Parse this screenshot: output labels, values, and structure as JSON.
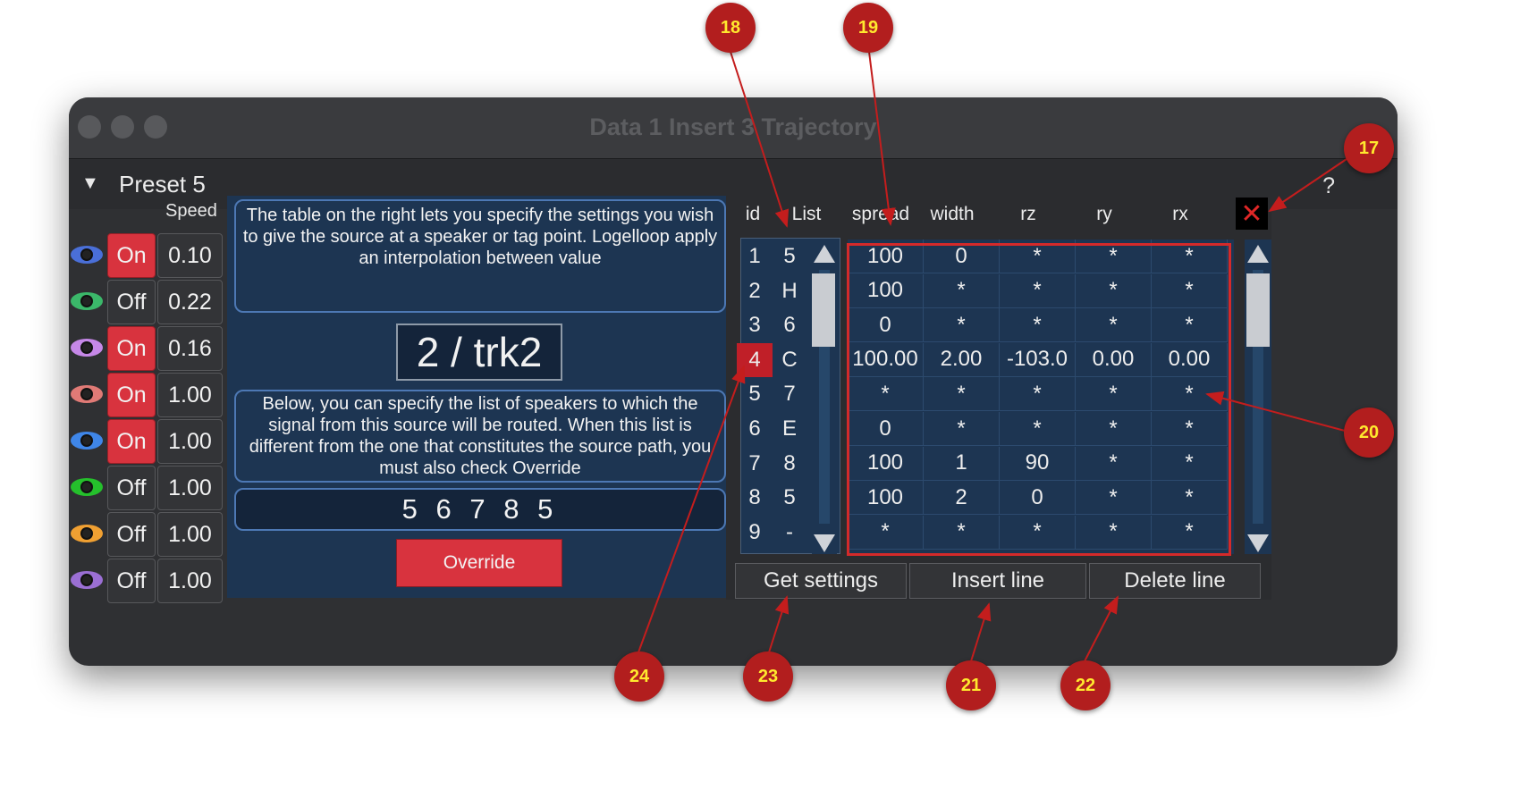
{
  "window": {
    "title": "Data 1 Insert 3 Trajectory"
  },
  "preset": {
    "label": "Preset 5",
    "help": "?"
  },
  "left": {
    "speed_header": "Speed",
    "rows": [
      {
        "eye_color": "#4a6fd8",
        "state": "On",
        "speed": "0.10"
      },
      {
        "eye_color": "#3bb86a",
        "state": "Off",
        "speed": "0.22"
      },
      {
        "eye_color": "#c688e8",
        "state": "On",
        "speed": "0.16"
      },
      {
        "eye_color": "#e07a76",
        "state": "On",
        "speed": "1.00"
      },
      {
        "eye_color": "#3f86e8",
        "state": "On",
        "speed": "1.00"
      },
      {
        "eye_color": "#25c02c",
        "state": "Off",
        "speed": "1.00"
      },
      {
        "eye_color": "#f0a032",
        "state": "Off",
        "speed": "1.00"
      },
      {
        "eye_color": "#9b6fd4",
        "state": "Off",
        "speed": "1.00"
      }
    ]
  },
  "center": {
    "info_text": "The table on the right lets you specify the settings you wish to give the source at a speaker or tag point. Logelloop apply an interpolation between value",
    "track_label": "2 / trk2",
    "routing_text": "Below, you can specify the list of speakers to which the signal from this source will be routed. When this list is different from the one that constitutes the source path, you must also check Override",
    "speaker_list": "5 6 7 8 5",
    "override_label": "Override"
  },
  "table": {
    "headers": {
      "id": "id",
      "list": "List",
      "spread": "spread",
      "width": "width",
      "rz": "rz",
      "ry": "ry",
      "rx": "rx"
    },
    "close_icon": "x-icon",
    "rows": [
      {
        "id": "1",
        "list": "5",
        "spread": "100",
        "width": "0",
        "rz": "*",
        "ry": "*",
        "rx": "*"
      },
      {
        "id": "2",
        "list": "H",
        "spread": "100",
        "width": "*",
        "rz": "*",
        "ry": "*",
        "rx": "*"
      },
      {
        "id": "3",
        "list": "6",
        "spread": "0",
        "width": "*",
        "rz": "*",
        "ry": "*",
        "rx": "*"
      },
      {
        "id": "4",
        "list": "C",
        "spread": "100.00",
        "width": "2.00",
        "rz": "-103.0",
        "ry": "0.00",
        "rx": "0.00"
      },
      {
        "id": "5",
        "list": "7",
        "spread": "*",
        "width": "*",
        "rz": "*",
        "ry": "*",
        "rx": "*"
      },
      {
        "id": "6",
        "list": "E",
        "spread": "0",
        "width": "*",
        "rz": "*",
        "ry": "*",
        "rx": "*"
      },
      {
        "id": "7",
        "list": "8",
        "spread": "100",
        "width": "1",
        "rz": "90",
        "ry": "*",
        "rx": "*"
      },
      {
        "id": "8",
        "list": "5",
        "spread": "100",
        "width": "2",
        "rz": "0",
        "ry": "*",
        "rx": "*"
      },
      {
        "id": "9",
        "list": "-",
        "spread": "*",
        "width": "*",
        "rz": "*",
        "ry": "*",
        "rx": "*"
      }
    ],
    "selected_id": "4"
  },
  "buttons": {
    "get_settings": "Get settings",
    "insert_line": "Insert line",
    "delete_line": "Delete line"
  },
  "callouts": [
    "17",
    "18",
    "19",
    "20",
    "21",
    "22",
    "23",
    "24"
  ],
  "colors": {
    "accent_red": "#d8333e",
    "panel_blue": "#1d3552",
    "callout": "#b21e1e",
    "callout_text": "#ffe92e"
  }
}
